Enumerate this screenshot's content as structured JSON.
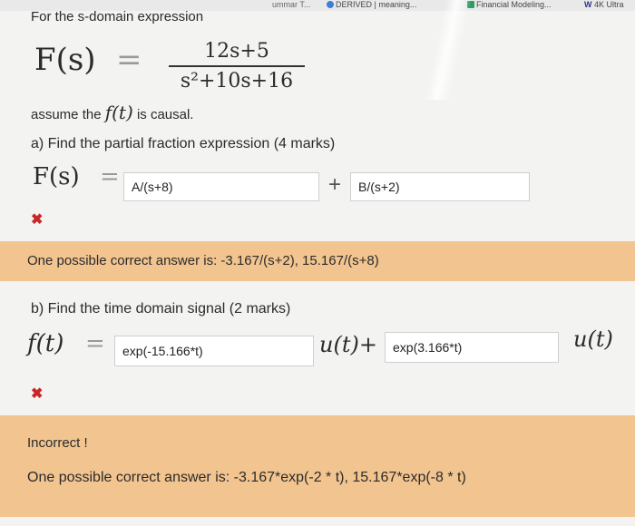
{
  "bookmarks": {
    "fragment": "ummar T...",
    "derived": "DERIVED | meaning...",
    "financial": "Financial Modeling...",
    "ultra_mark": "W",
    "ultra": "4K Ultra"
  },
  "question": {
    "intro": "For the s-domain expression",
    "fs_lhs": "F(s)",
    "equals": "=",
    "numerator": "12s+5",
    "denominator": "s²+10s+16",
    "causal_prefix": "assume the",
    "causal_ft": "f(t)",
    "causal_suffix": "is causal."
  },
  "part_a": {
    "prompt": "a) Find the partial fraction expression (4 marks)",
    "lhs": "F(s)",
    "equals": "=",
    "input1_value": "A/(s+8)",
    "plus": "+",
    "input2_value": "B/(s+2)",
    "status_mark": "✖",
    "feedback": "One possible correct answer is: -3.167/(s+2), 15.167/(s+8)"
  },
  "part_b": {
    "prompt": "b) Find the time domain signal (2 marks)",
    "lhs": "f(t)",
    "equals": "=",
    "input1_value": "exp(-15.166*t)",
    "term1": "u(t)+",
    "input2_value": "exp(3.166*t)",
    "term2": "u(t)",
    "status_mark": "✖",
    "incorrect_label": "Incorrect !",
    "feedback": "One possible correct answer is: -3.167*exp(-2 * t), 15.167*exp(-8 * t)"
  },
  "colors": {
    "feedback_bg": "#f2c48f",
    "error": "#c62828"
  }
}
